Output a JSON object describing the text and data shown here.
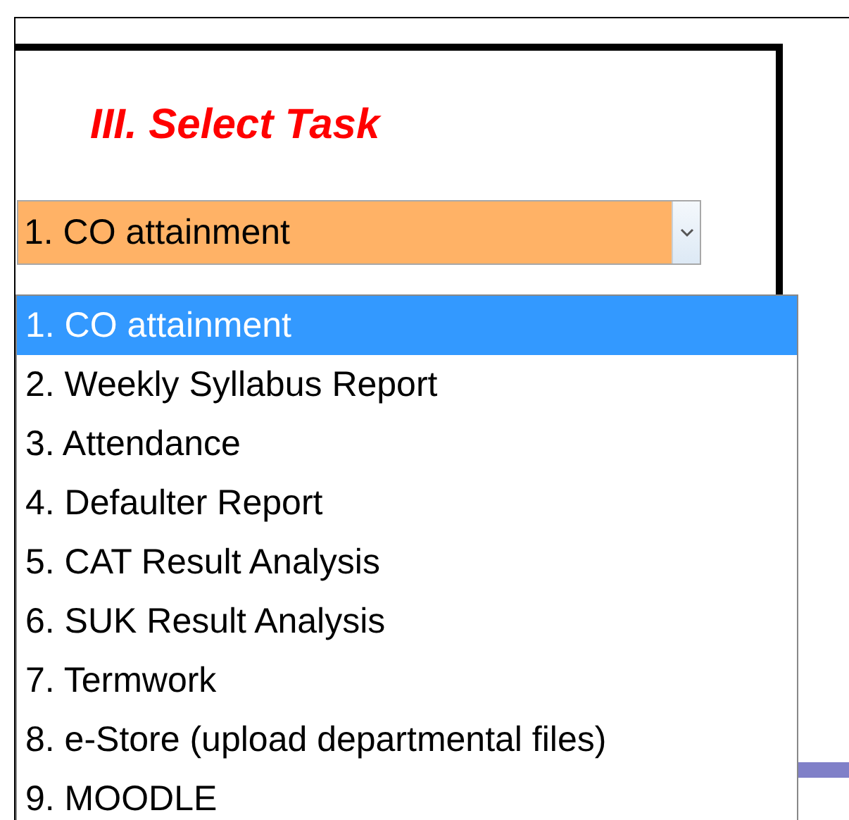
{
  "heading": "III. Select Task",
  "select": {
    "value": "1. CO attainment"
  },
  "options": [
    {
      "label": "1. CO attainment",
      "selected": true
    },
    {
      "label": "2. Weekly Syllabus Report",
      "selected": false
    },
    {
      "label": "3. Attendance",
      "selected": false
    },
    {
      "label": "4. Defaulter Report",
      "selected": false
    },
    {
      "label": "5. CAT Result Analysis",
      "selected": false
    },
    {
      "label": "6. SUK Result Analysis",
      "selected": false
    },
    {
      "label": "7. Termwork",
      "selected": false
    },
    {
      "label": "8. e-Store (upload departmental files)",
      "selected": false
    },
    {
      "label": "9. MOODLE",
      "selected": false
    }
  ]
}
